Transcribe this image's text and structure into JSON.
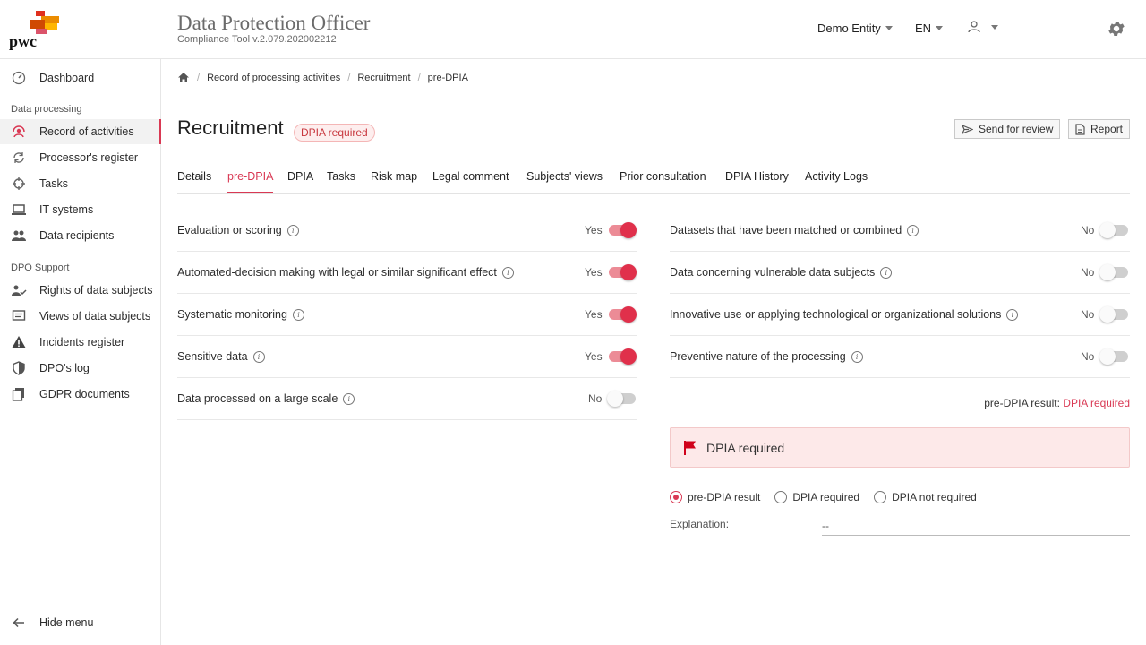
{
  "header": {
    "logo_text": "pwc",
    "title": "Data Protection Officer",
    "subtitle": "Compliance Tool v.2.079.202002212",
    "entity": "Demo Entity",
    "language": "EN",
    "user_icon": "user-icon",
    "settings_icon": "gear-icon"
  },
  "sidebar": {
    "dashboard": "Dashboard",
    "section_processing": "Data processing",
    "items_processing": [
      {
        "label": "Record of activities",
        "icon": "record-icon"
      },
      {
        "label": "Processor's register",
        "icon": "sync-icon"
      },
      {
        "label": "Tasks",
        "icon": "crosshair-icon"
      },
      {
        "label": "IT systems",
        "icon": "laptop-icon"
      },
      {
        "label": "Data recipients",
        "icon": "people-icon"
      }
    ],
    "section_support": "DPO Support",
    "items_support": [
      {
        "label": "Rights of data subjects",
        "icon": "person-check-icon"
      },
      {
        "label": "Views of data subjects",
        "icon": "comment-icon"
      },
      {
        "label": "Incidents register",
        "icon": "warning-icon"
      },
      {
        "label": "DPO's log",
        "icon": "shield-icon"
      },
      {
        "label": "GDPR documents",
        "icon": "documents-icon"
      }
    ],
    "hide_menu": "Hide menu"
  },
  "breadcrumb": [
    "Record of processing activities",
    "Recruitment",
    "pre-DPIA"
  ],
  "page": {
    "title": "Recruitment",
    "badge": "DPIA required",
    "send_review": "Send for review",
    "report": "Report"
  },
  "tabs": [
    "Details",
    "pre-DPIA",
    "DPIA",
    "Tasks",
    "Risk map",
    "Legal comment",
    "Subjects' views",
    "Prior consultation",
    "DPIA History",
    "Activity Logs"
  ],
  "criteria_left": [
    {
      "label": "Evaluation or scoring",
      "answer": "Yes",
      "on": true
    },
    {
      "label": "Automated-decision making with legal or similar significant effect",
      "answer": "Yes",
      "on": true
    },
    {
      "label": "Systematic monitoring",
      "answer": "Yes",
      "on": true
    },
    {
      "label": "Sensitive data",
      "answer": "Yes",
      "on": true
    },
    {
      "label": "Data processed on a large scale",
      "answer": "No",
      "on": false
    }
  ],
  "criteria_right": [
    {
      "label": "Datasets that have been matched or combined",
      "answer": "No",
      "on": false
    },
    {
      "label": "Data concerning vulnerable data subjects",
      "answer": "No",
      "on": false
    },
    {
      "label": "Innovative use or applying technological or organizational solutions",
      "answer": "No",
      "on": false
    },
    {
      "label": "Preventive nature of the processing",
      "answer": "No",
      "on": false
    }
  ],
  "result": {
    "label": "pre-DPIA result:",
    "value": "DPIA required",
    "alert": "DPIA required",
    "options": [
      {
        "label": "pre-DPIA result",
        "selected": true
      },
      {
        "label": "DPIA required",
        "selected": false
      },
      {
        "label": "DPIA not required",
        "selected": false
      }
    ],
    "explanation_label": "Explanation:",
    "explanation_value": "--"
  },
  "colors": {
    "accent": "#d93954",
    "brand_orange": "#e8701a"
  }
}
